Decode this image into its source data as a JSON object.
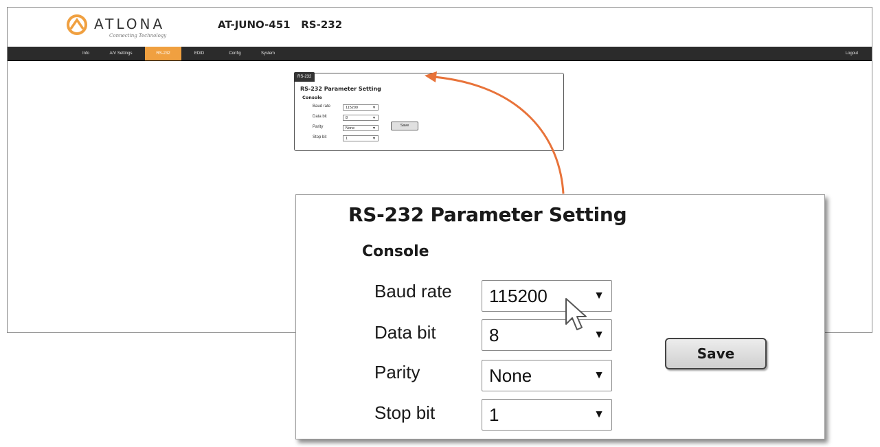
{
  "header": {
    "brand_name": "ATLONA",
    "brand_tagline": "Connecting Technology",
    "device_title": "AT-JUNO-451   RS-232"
  },
  "nav": {
    "items": [
      {
        "label": "Info"
      },
      {
        "label": "A/V Settings"
      },
      {
        "label": "RS-232",
        "active": true
      },
      {
        "label": "EDID"
      },
      {
        "label": "Config"
      },
      {
        "label": "System"
      }
    ],
    "logout": "Logout"
  },
  "panel": {
    "tab": "RS-232",
    "title": "RS-232 Parameter Setting",
    "section": "Console",
    "fields": [
      {
        "label": "Baud rate",
        "value": "115200"
      },
      {
        "label": "Data bit",
        "value": "8"
      },
      {
        "label": "Parity",
        "value": "None"
      },
      {
        "label": "Stop bit",
        "value": "1"
      }
    ],
    "save_label": "Save"
  },
  "icons": {
    "dropdown": "triangle-down-icon",
    "logo": "atlona-logo-icon",
    "cursor": "mouse-pointer-icon"
  },
  "colors": {
    "accent": "#f0a040",
    "navbar": "#2b2b2b",
    "callout_arrow": "#e8733a"
  }
}
